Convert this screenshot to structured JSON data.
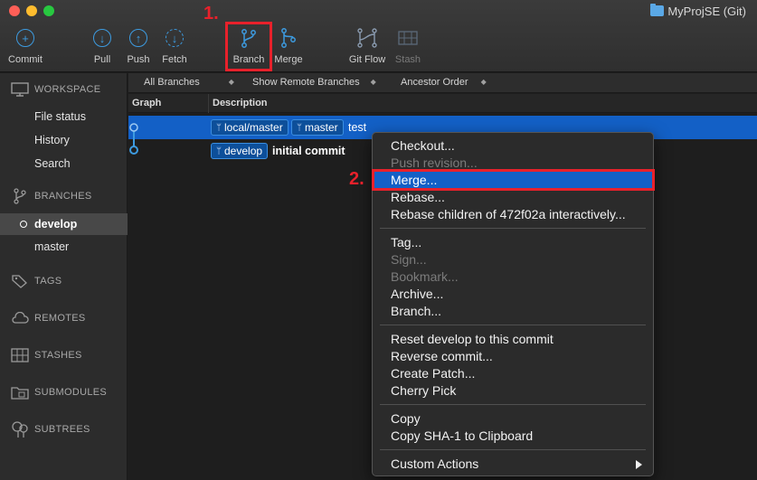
{
  "window": {
    "title": "MyProjSE (Git)",
    "title_icon": "folder-icon"
  },
  "toolbar": {
    "buttons": [
      {
        "id": "commit",
        "label": "Commit",
        "icon": "plus-circle-icon",
        "enabled": true
      },
      {
        "id": "pull",
        "label": "Pull",
        "icon": "arrow-down-circle-icon",
        "enabled": true
      },
      {
        "id": "push",
        "label": "Push",
        "icon": "arrow-up-circle-icon",
        "enabled": true
      },
      {
        "id": "fetch",
        "label": "Fetch",
        "icon": "arrow-down-dashed-circle-icon",
        "enabled": true
      },
      {
        "id": "branch",
        "label": "Branch",
        "icon": "branch-icon",
        "enabled": true
      },
      {
        "id": "merge",
        "label": "Merge",
        "icon": "merge-icon",
        "enabled": true
      },
      {
        "id": "gitflow",
        "label": "Git Flow",
        "icon": "git-flow-icon",
        "enabled": true
      },
      {
        "id": "stash",
        "label": "Stash",
        "icon": "stash-icon",
        "enabled": false
      }
    ]
  },
  "annotations": {
    "step1": "1.",
    "step2": "2.",
    "color": "#e8212b"
  },
  "sidebar": {
    "workspace": {
      "header": "WORKSPACE",
      "items": [
        "File status",
        "History",
        "Search"
      ]
    },
    "branches": {
      "header": "BRANCHES",
      "items": [
        {
          "label": "develop",
          "current": true
        },
        {
          "label": "master",
          "current": false
        }
      ]
    },
    "sections": [
      "TAGS",
      "REMOTES",
      "STASHES",
      "SUBMODULES",
      "SUBTREES"
    ]
  },
  "filters": {
    "branches": "All Branches",
    "remote": "Show Remote Branches",
    "order": "Ancestor Order"
  },
  "columns": {
    "graph": "Graph",
    "description": "Description"
  },
  "commits": [
    {
      "tags": [
        "local/master",
        "master"
      ],
      "message": "test",
      "selected": true
    },
    {
      "tags": [
        "develop"
      ],
      "message": "initial commit",
      "selected": false
    }
  ],
  "context_menu": {
    "groups": [
      [
        {
          "label": "Checkout...",
          "enabled": true
        },
        {
          "label": "Push revision...",
          "enabled": false
        },
        {
          "label": "Merge...",
          "enabled": true,
          "highlighted": true
        },
        {
          "label": "Rebase...",
          "enabled": true
        },
        {
          "label": "Rebase children of 472f02a interactively...",
          "enabled": true
        }
      ],
      [
        {
          "label": "Tag...",
          "enabled": true
        },
        {
          "label": "Sign...",
          "enabled": false
        },
        {
          "label": "Bookmark...",
          "enabled": false
        },
        {
          "label": "Archive...",
          "enabled": true
        },
        {
          "label": "Branch...",
          "enabled": true
        }
      ],
      [
        {
          "label": "Reset develop to this commit",
          "enabled": true
        },
        {
          "label": "Reverse commit...",
          "enabled": true
        },
        {
          "label": "Create Patch...",
          "enabled": true
        },
        {
          "label": "Cherry Pick",
          "enabled": true
        }
      ],
      [
        {
          "label": "Copy",
          "enabled": true
        },
        {
          "label": "Copy SHA-1 to Clipboard",
          "enabled": true
        }
      ],
      [
        {
          "label": "Custom Actions",
          "enabled": true,
          "submenu": true
        }
      ]
    ]
  },
  "colors": {
    "accent": "#3d9be0",
    "selection": "#1360c6",
    "branch_tag": "#0d4f9a"
  }
}
